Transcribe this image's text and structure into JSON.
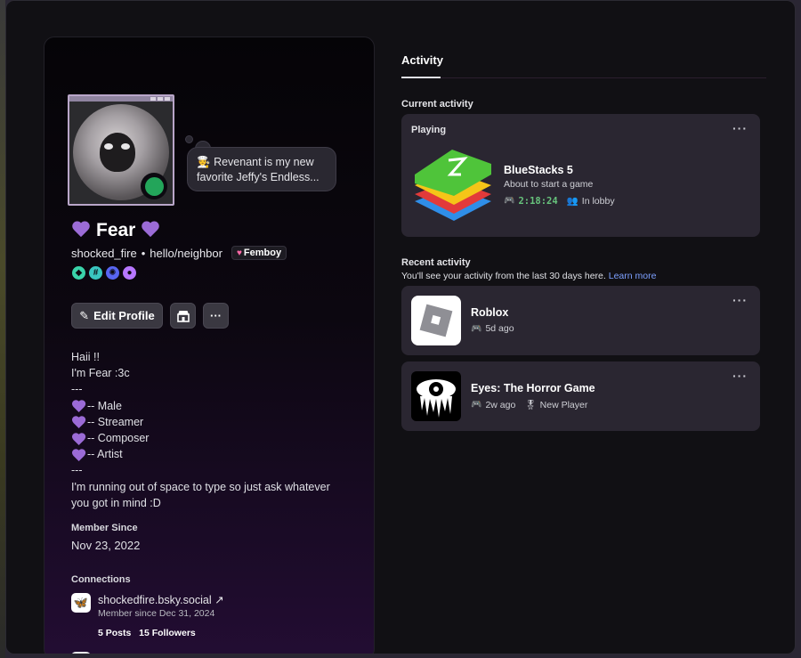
{
  "profile": {
    "bubble_emoji": "🧑‍🍳",
    "status_text": "Revenant is my new favorite Jeffy's Endless...",
    "display_name": "Fear",
    "username": "shocked_fire",
    "pronouns": "hello/neighbor",
    "tag_text": "Femboy",
    "badges": [
      {
        "name": "hypesquad-badge",
        "glyph": "◆",
        "color": "#3ad3a9"
      },
      {
        "name": "hashtag-badge",
        "glyph": "#",
        "color": "#3ac6c0"
      },
      {
        "name": "quest-badge",
        "glyph": "✺",
        "color": "#5865f2"
      },
      {
        "name": "nitro-badge",
        "glyph": "●",
        "color": "#b777ff"
      }
    ],
    "edit_button": "Edit Profile",
    "bio_lines": [
      "Haii !!",
      "I'm Fear :3c",
      "---"
    ],
    "bio_hearts": [
      "-- Male",
      "-- Streamer",
      "-- Composer",
      "-- Artist"
    ],
    "bio_sep": "---",
    "bio_tail": "I'm running out of space to type so just ask whatever you got in mind :D",
    "member_since_label": "Member Since",
    "member_since": "Nov 23, 2022",
    "connections_label": "Connections",
    "connection": {
      "name": "shockedfire.bsky.social ↗",
      "since": "Member since Dec 31, 2024",
      "posts": "5",
      "posts_label": "Posts",
      "followers": "15",
      "followers_label": "Followers"
    }
  },
  "activity": {
    "tab": "Activity",
    "current_label": "Current activity",
    "current": {
      "state": "Playing",
      "game": "BlueStacks 5",
      "details": "About to start a game",
      "elapsed": "2:18:24",
      "party": "In lobby"
    },
    "recent_label": "Recent activity",
    "recent_desc": "You'll see your activity from the last 30 days here.",
    "learn_more": "Learn more",
    "recent": [
      {
        "game": "Roblox",
        "ago": "5d ago"
      },
      {
        "game": "Eyes: The Horror Game",
        "ago": "2w ago",
        "extra": "New Player"
      }
    ],
    "more": "···"
  },
  "colors": {
    "online": "#23a55a",
    "accent_link": "#7da0ff",
    "timer": "#67c37c"
  }
}
